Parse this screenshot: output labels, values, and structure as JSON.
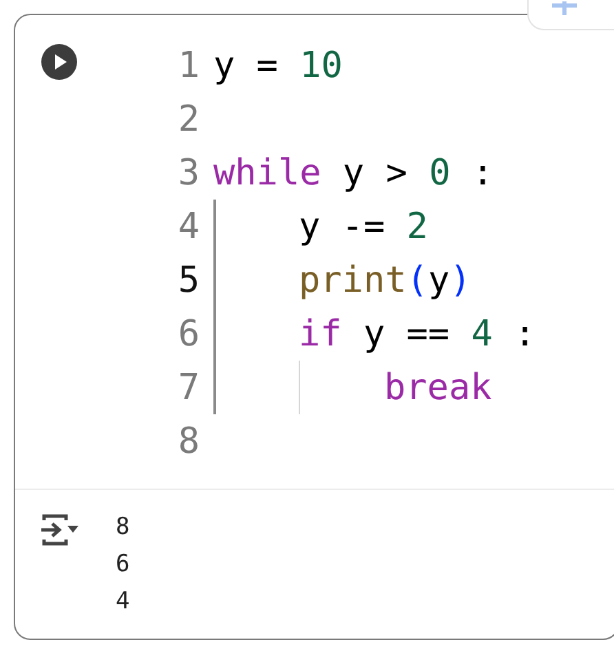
{
  "code": {
    "lines": [
      {
        "number": "1",
        "current": false,
        "tokens": [
          {
            "kind": "plain",
            "text": "y = "
          },
          {
            "kind": "number",
            "text": "10"
          }
        ]
      },
      {
        "number": "2",
        "current": false
      },
      {
        "number": "3",
        "current": false,
        "tokens": [
          {
            "kind": "keyword",
            "text": "while"
          },
          {
            "kind": "plain",
            "text": " y > "
          },
          {
            "kind": "number",
            "text": "0"
          },
          {
            "kind": "plain",
            "text": " :"
          }
        ],
        "children": [
          {
            "number": "4",
            "current": false,
            "tokens": [
              {
                "kind": "plain",
                "text": "y -= "
              },
              {
                "kind": "number",
                "text": "2"
              }
            ]
          },
          {
            "number": "5",
            "current": true,
            "tokens": [
              {
                "kind": "function",
                "text": "print"
              },
              {
                "kind": "paren",
                "text": "("
              },
              {
                "kind": "plain",
                "text": "y"
              },
              {
                "kind": "paren",
                "text": ")"
              }
            ]
          },
          {
            "number": "6",
            "current": false,
            "tokens": [
              {
                "kind": "keyword",
                "text": "if"
              },
              {
                "kind": "plain",
                "text": " y == "
              },
              {
                "kind": "number",
                "text": "4"
              },
              {
                "kind": "plain",
                "text": " :"
              }
            ],
            "children": [
              {
                "number": "7",
                "current": false,
                "tokens": [
                  {
                    "kind": "keyword",
                    "text": "break"
                  }
                ]
              }
            ]
          }
        ]
      },
      {
        "number": "8",
        "current": false
      }
    ]
  },
  "output": {
    "lines": [
      "8",
      "6",
      "4"
    ]
  }
}
